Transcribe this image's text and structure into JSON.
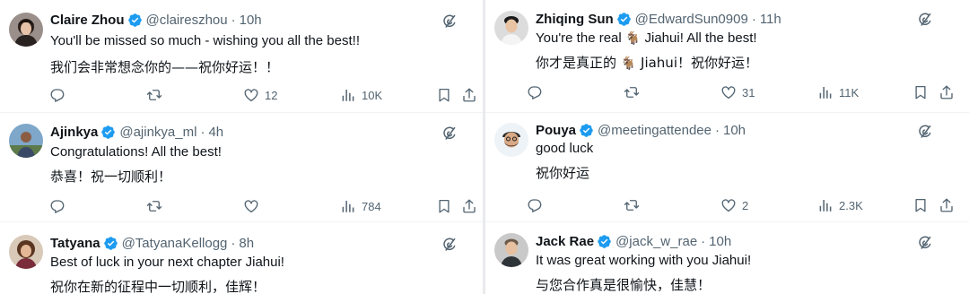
{
  "tweets": [
    {
      "name": "Claire Zhou",
      "handle": "@claireszhou",
      "time": "10h",
      "text1": "You'll be missed so much - wishing you all the best!!",
      "text2": "我们会非常想念你的——祝你好运！！",
      "likes": "12",
      "views": "10K"
    },
    {
      "name": "Ajinkya",
      "handle": "@ajinkya_ml",
      "time": "4h",
      "text1": "Congratulations! All the best!",
      "text2": "恭喜！祝一切顺利！",
      "likes": "",
      "views": "784"
    },
    {
      "name": "Tatyana",
      "handle": "@TatyanaKellogg",
      "time": "8h",
      "text1": "Best of luck in your next chapter Jiahui!",
      "text2": "祝你在新的征程中一切顺利，佳辉！"
    },
    {
      "name": "Zhiqing Sun",
      "handle": "@EdwardSun0909",
      "time": "11h",
      "text1_a": "You're the real",
      "text1_emoji": "🐐",
      "text1_b": "Jiahui! All the best!",
      "text2_a": "你才是真正的",
      "text2_emoji": "🐐",
      "text2_b": "Jiahui！祝你好运！",
      "likes": "31",
      "views": "11K"
    },
    {
      "name": "Pouya",
      "handle": "@meetingattendee",
      "time": "10h",
      "text1": "good luck",
      "text2": "祝你好运",
      "likes": "2",
      "views": "2.3K"
    },
    {
      "name": "Jack Rae",
      "handle": "@jack_w_rae",
      "time": "10h",
      "text1": "It was great working with you Jiahui!",
      "text2": "与您合作真是很愉快，佳慧！"
    }
  ],
  "separator": "·",
  "colors": {
    "verified": "#1d9bf0",
    "muted": "#536471",
    "text": "#0f1419",
    "divider": "#eff3f4"
  },
  "icons": [
    "verified-badge-icon",
    "grok-icon",
    "reply-icon",
    "retweet-icon",
    "like-icon",
    "views-icon",
    "bookmark-icon",
    "share-icon"
  ]
}
